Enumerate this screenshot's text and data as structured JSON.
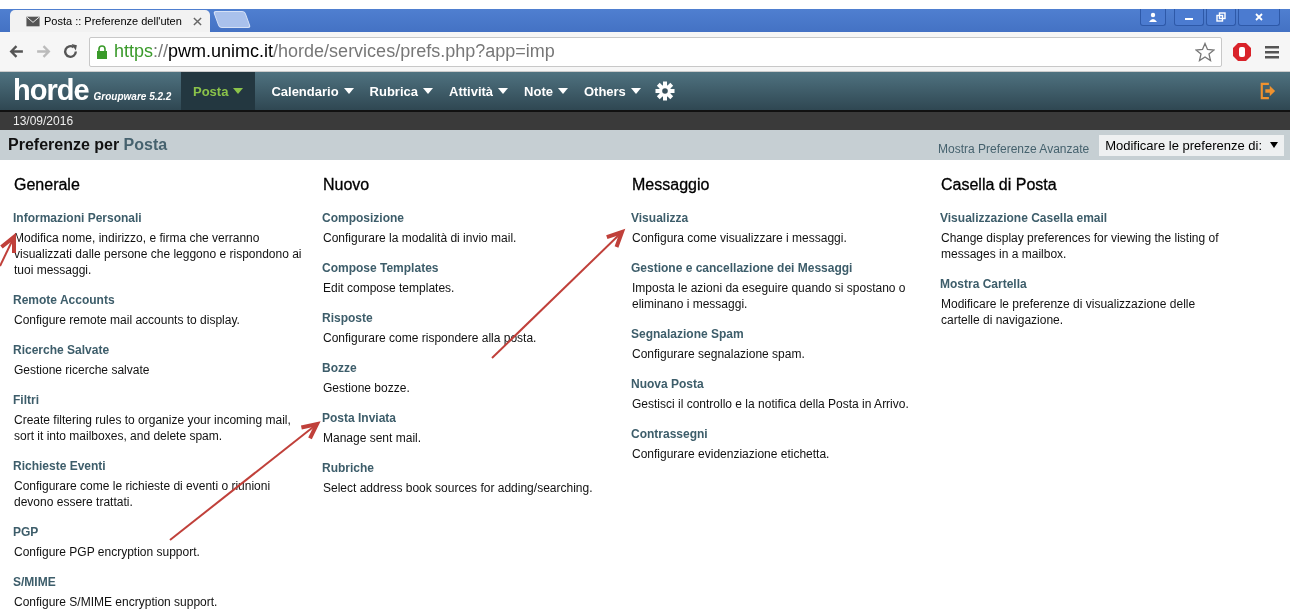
{
  "browser": {
    "tab_title": "Posta :: Preferenze dell'uten",
    "url": {
      "scheme": "https",
      "separator": "://",
      "host": "pwm.unimc.it",
      "path": "/horde/services/prefs.php?app=imp"
    }
  },
  "app": {
    "logo": "horde",
    "edition": "Groupware 5.2.2",
    "menu": [
      {
        "label": "Posta",
        "selected": true
      },
      {
        "label": "Calendario",
        "selected": false
      },
      {
        "label": "Rubrica",
        "selected": false
      },
      {
        "label": "Attività",
        "selected": false
      },
      {
        "label": "Note",
        "selected": false
      },
      {
        "label": "Others",
        "selected": false
      }
    ],
    "date": "13/09/2016"
  },
  "header": {
    "title": "Preferenze per",
    "app_name": "Posta",
    "advanced_link": "Mostra Preferenze Avanzate",
    "select_value": "Modificare le preferenze di:"
  },
  "columns": [
    {
      "title": "Generale",
      "items": [
        {
          "name": "Informazioni Personali",
          "description": "Modifica nome, indirizzo, e firma che verranno visualizzati dalle persone che leggono e rispondono ai tuoi messaggi."
        },
        {
          "name": "Remote Accounts",
          "description": "Configure remote mail accounts to display."
        },
        {
          "name": "Ricerche Salvate",
          "description": "Gestione ricerche salvate"
        },
        {
          "name": "Filtri",
          "description": "Create filtering rules to organize your incoming mail, sort it into mailboxes, and delete spam."
        },
        {
          "name": "Richieste Eventi",
          "description": "Configurare come le richieste di eventi o riunioni devono essere trattati."
        },
        {
          "name": "PGP",
          "description": "Configure PGP encryption support."
        },
        {
          "name": "S/MIME",
          "description": "Configure S/MIME encryption support."
        }
      ]
    },
    {
      "title": "Nuovo",
      "items": [
        {
          "name": "Composizione",
          "description": "Configurare la modalità di invio mail."
        },
        {
          "name": "Compose Templates",
          "description": "Edit compose templates."
        },
        {
          "name": "Risposte",
          "description": "Configurare come rispondere alla posta."
        },
        {
          "name": "Bozze",
          "description": "Gestione bozze."
        },
        {
          "name": "Posta Inviata",
          "description": "Manage sent mail."
        },
        {
          "name": "Rubriche",
          "description": "Select address book sources for adding/searching."
        }
      ]
    },
    {
      "title": "Messaggio",
      "items": [
        {
          "name": "Visualizza",
          "description": "Configura come visualizzare i messaggi."
        },
        {
          "name": "Gestione e cancellazione dei Messaggi",
          "description": "Imposta le azioni da eseguire quando si spostano o eliminano i messaggi."
        },
        {
          "name": "Segnalazione Spam",
          "description": "Configurare segnalazione spam."
        },
        {
          "name": "Nuova Posta",
          "description": "Gestisci il controllo e la notifica della Posta in Arrivo."
        },
        {
          "name": "Contrassegni",
          "description": "Configurare evidenziazione etichetta."
        }
      ]
    },
    {
      "title": "Casella di Posta",
      "items": [
        {
          "name": "Visualizzazione Casella email",
          "description": "Change display preferences for viewing the listing of messages in a mailbox."
        },
        {
          "name": "Mostra Cartella",
          "description": "Modificare le preferenze di visualizzazione delle cartelle di navigazione."
        }
      ]
    }
  ]
}
